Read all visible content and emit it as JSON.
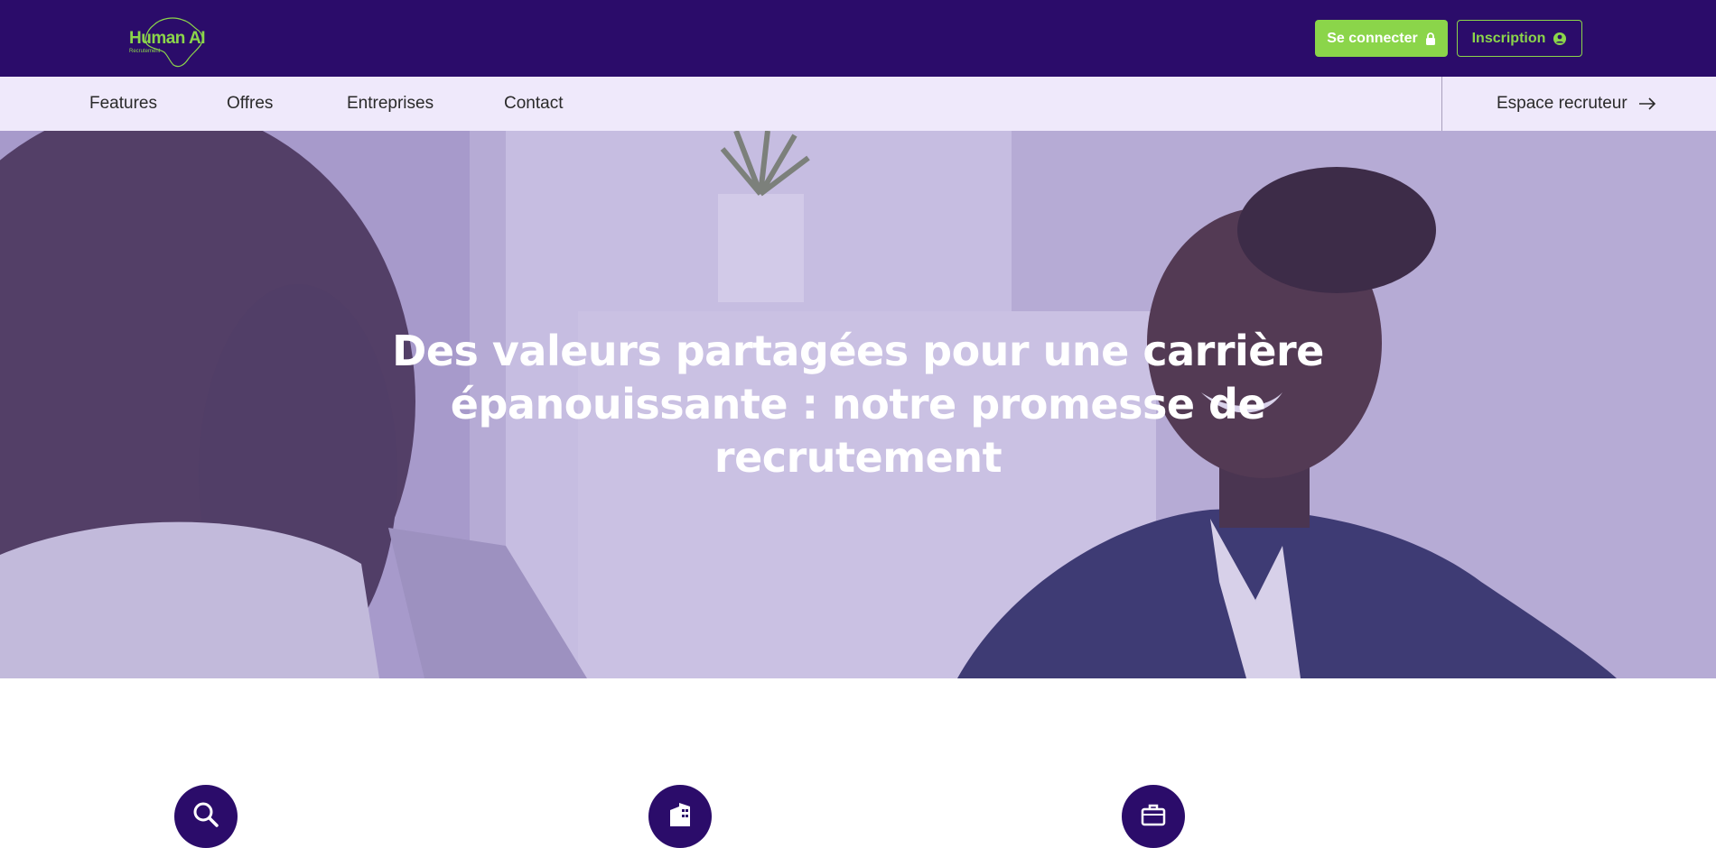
{
  "header": {
    "logo": {
      "text": "Human AI",
      "subtext": "Recrutement"
    },
    "login_label": "Se connecter",
    "signup_label": "Inscription"
  },
  "nav": {
    "items": [
      {
        "label": "Features"
      },
      {
        "label": "Offres"
      },
      {
        "label": "Entreprises"
      },
      {
        "label": "Contact"
      }
    ],
    "recruiter_label": "Espace recruteur"
  },
  "hero": {
    "title": "Des valeurs partagées pour une carrière épanouissante : notre promesse de recrutement"
  },
  "features": {
    "icons": [
      "search-icon",
      "building-icon",
      "briefcase-icon"
    ]
  },
  "colors": {
    "primary": "#2b0c6a",
    "accent": "#8bd54a",
    "nav_bg": "#efe9fb"
  }
}
